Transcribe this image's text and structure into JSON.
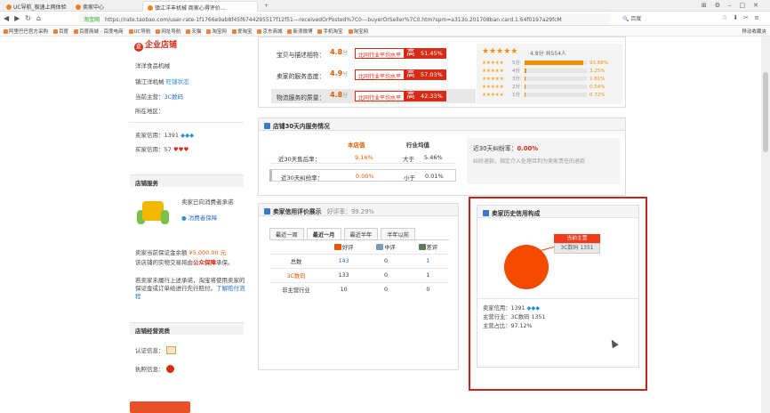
{
  "browser": {
    "tabs": [
      {
        "label": "UC导航_极速上网体验",
        "color": "#f07d1e"
      },
      {
        "label": "卖家中心",
        "color": "#f07d1e"
      },
      {
        "label": "镇江洋丰机械 商家心得评价...",
        "color": "#f07d1e"
      }
    ],
    "url_secure_label": "淘宝网",
    "url": "https://rate.taobao.com/user-rate-1f1766e9ab8f45f6744295517f12f51---receivedOrPosted%7C0---buyerOrSeller%7C0.htm?spm=a313o.201708ban.card.1.64f0197a29fcM",
    "search_label": "百度",
    "bookmarks": [
      "阿里巴巴官方采购",
      "百度",
      "百度商城 - 百度电商",
      "UC导航",
      "网址导航",
      "天猫",
      "淘宝网",
      "爱淘宝",
      "京东商城",
      "新浪微博",
      "手机淘宝",
      "淘宝网"
    ],
    "bookmarks_right": "移动收藏夹"
  },
  "left": {
    "badge": "企业店铺",
    "shop_name": "洋洋食品机械",
    "company": "镇江洋机械",
    "company_tag": "旺铺状态",
    "main_label": "当前主营：",
    "main_value": "3C数码",
    "location_label": "所在地区：",
    "seller_credit_label": "卖家信用：",
    "seller_credit_value": "1391",
    "buyer_credit_label": "买家信用：",
    "buyer_credit_value": "57",
    "service_title": "店铺服务",
    "service_desc": "卖家已向消费者承诺",
    "service_link": "消费者保障",
    "deposit_label": "卖家当前保证金余额",
    "deposit_value": "¥5,000.00",
    "deposit_unit": "元",
    "deposit_text": "该店铺的实物交易将由",
    "deposit_link": "公众保障",
    "deposit_tail": "承保。",
    "warn_text": "若卖家未履行上述承诺，淘宝将使用卖家的保证金或订单给进行先行赔付。",
    "warn_link": "了解赔付流程",
    "qual_title": "店铺经营资质",
    "cert_label": "认证信息：",
    "license_label": "执照信息："
  },
  "scores": {
    "rows": [
      {
        "label": "宝贝与描述相符：",
        "value": "4.8",
        "unit": "分",
        "compare": "比同行业平均水平",
        "dir": "高",
        "pct": "51.45%"
      },
      {
        "label": "卖家的服务态度：",
        "value": "4.9",
        "unit": "分",
        "compare": "比同行业平均水平",
        "dir": "高",
        "pct": "57.03%"
      },
      {
        "label": "物流服务的质量：",
        "value": "4.8",
        "unit": "分",
        "compare": "比同行业平均水平",
        "dir": "高",
        "pct": "42.33%"
      }
    ],
    "avg_text": "4.8分 共554人",
    "dist": [
      {
        "label": "5分",
        "pct": "93.68%",
        "fill": 0.9368
      },
      {
        "label": "4分",
        "pct": "3.25%",
        "fill": 0.0325
      },
      {
        "label": "3分",
        "pct": "1.81%",
        "fill": 0.0181
      },
      {
        "label": "2分",
        "pct": "0.54%",
        "fill": 0.0054
      },
      {
        "label": "1分",
        "pct": "0.72%",
        "fill": 0.0072
      }
    ]
  },
  "service": {
    "title": "店铺30天内服务情况",
    "col_shop": "本店值",
    "col_avg": "行业均值",
    "rows": [
      {
        "label": "近30天售后率：",
        "shop": "9.16%",
        "cmp": "大于",
        "avg": "5.46%"
      },
      {
        "label": "近30天纠纷率：",
        "shop": "0.00%",
        "cmp": "小于",
        "avg": "0.01%"
      }
    ],
    "note_title": "近30天纠纷率：",
    "note_value": "0.00%",
    "note_desc": "纠纷退款，指定介入处理且判为卖家责任的退款"
  },
  "rating": {
    "title": "卖家信用评价展示",
    "subtitle": "好评率：",
    "rate": "99.29%",
    "tabs": [
      "最近一周",
      "最近一月",
      "最近半年",
      "半年以前"
    ],
    "active_tab": 1,
    "headers": [
      "",
      "好评",
      "中评",
      "差评"
    ],
    "rows": [
      {
        "label": "总数",
        "good": "143",
        "mid": "0",
        "bad": "1"
      },
      {
        "label": "3C数码",
        "good": "133",
        "mid": "0",
        "bad": "1"
      },
      {
        "label": "非主营行业",
        "good": "10",
        "mid": "0",
        "bad": "0"
      }
    ]
  },
  "history": {
    "title": "卖家历史信用构成",
    "tag": "当前主营",
    "tag_value": "3C数码 1351",
    "credit_label": "卖家信用：",
    "credit_value": "1391",
    "main_label": "主营行业：",
    "main_value": "3C数码 1351",
    "share_label": "主营占比：",
    "share_value": "97.12%"
  },
  "colors": {
    "accent": "#d62b17",
    "orange": "#e25a00",
    "pie": "#f34a00",
    "highlight_border": "#c9231e"
  }
}
